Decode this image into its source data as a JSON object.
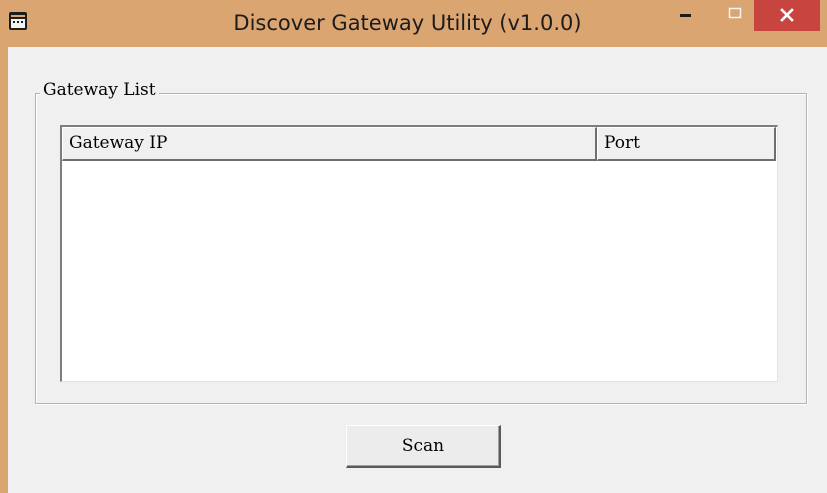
{
  "window": {
    "title": "Discover Gateway Utility (v1.0.0)",
    "titlebar_color": "#dba571",
    "close_button_color": "#c8453f",
    "icons": {
      "app": "app-window-icon",
      "minimize": "minimize-icon",
      "maximize": "maximize-icon",
      "close": "close-icon"
    }
  },
  "gateway_list": {
    "group_label": "Gateway List",
    "columns": [
      {
        "label": "Gateway IP"
      },
      {
        "label": "Port"
      }
    ],
    "rows": []
  },
  "actions": {
    "scan_label": "Scan"
  }
}
